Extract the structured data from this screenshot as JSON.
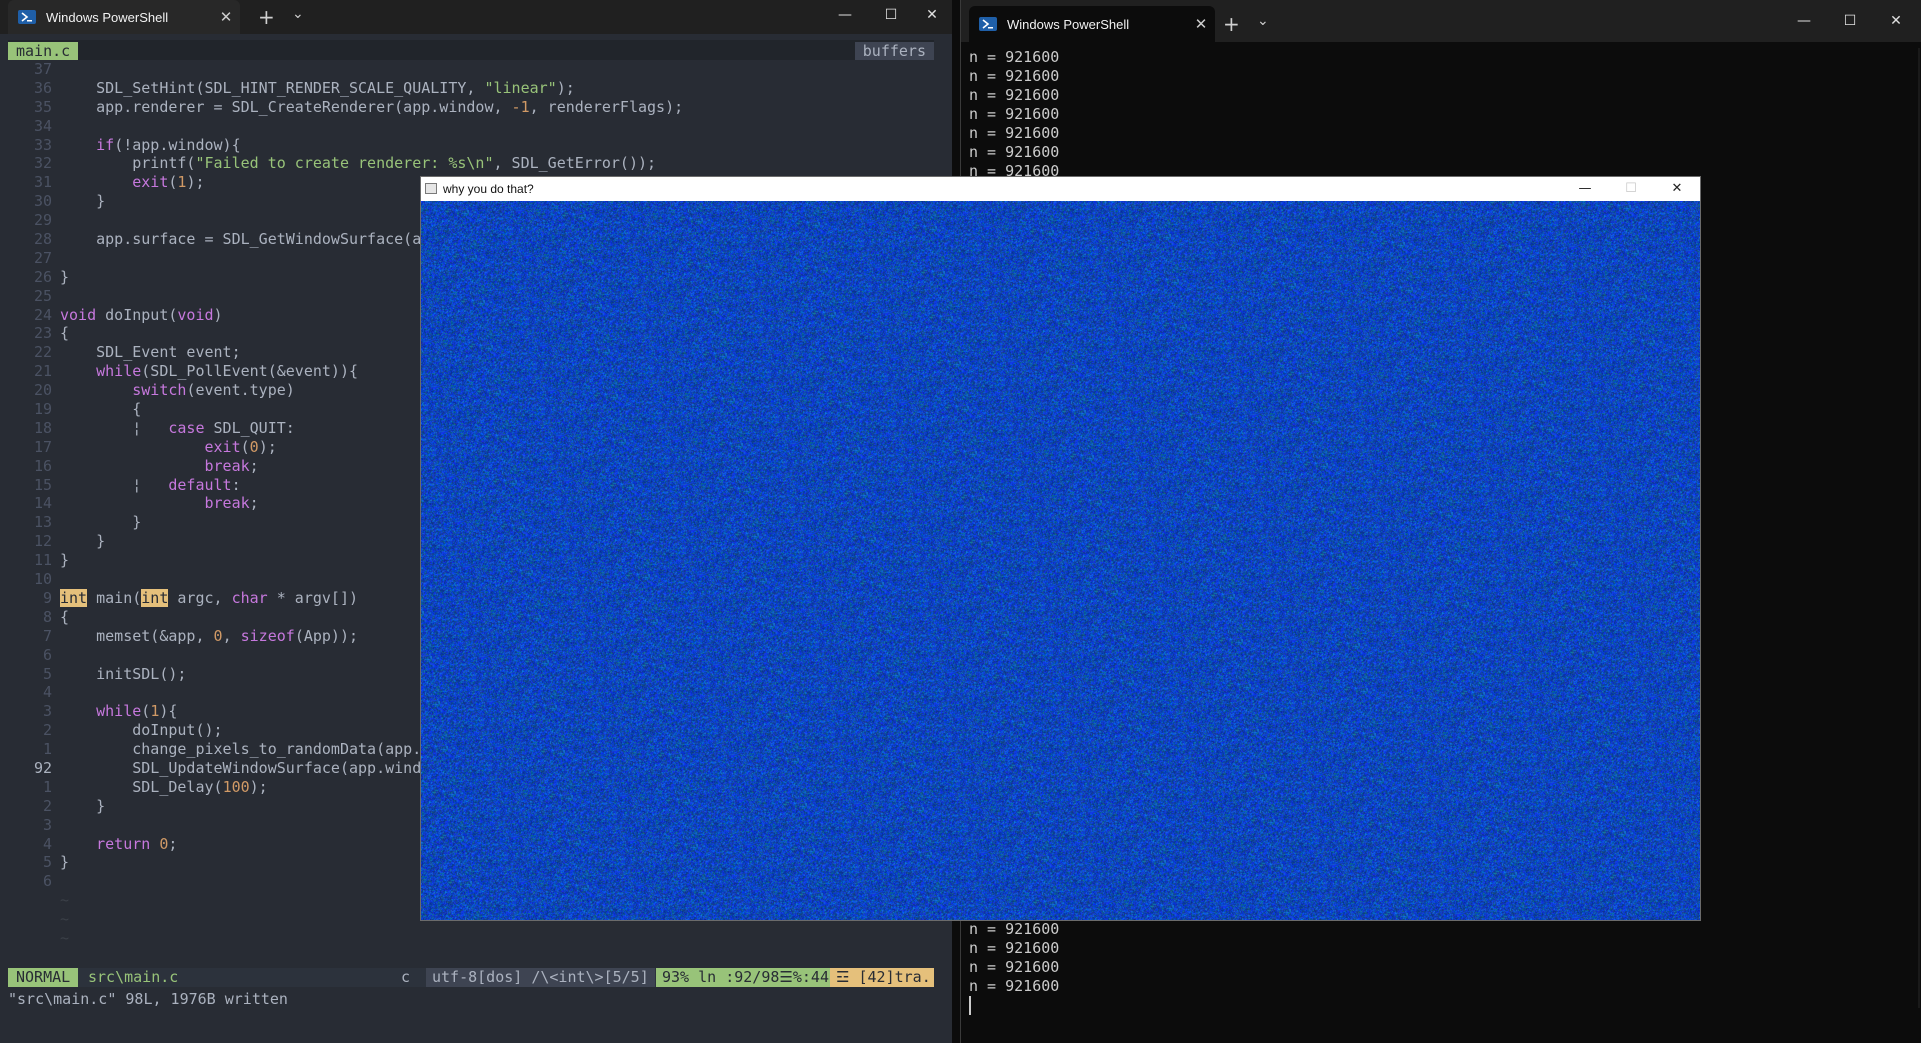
{
  "left_window": {
    "tab_title": "Windows PowerShell",
    "tab_close": "✕",
    "new_tab": "+",
    "dropdown": "⌄",
    "minimize": "—",
    "maximize": "☐",
    "close": "✕"
  },
  "vim": {
    "tab_label": "main.c",
    "buffers_label": "buffers",
    "mode": "NORMAL",
    "file": "src\\main.c",
    "filetype": "c",
    "encoding_search": "utf-8[dos] /\\<int\\>[5/5]",
    "position": "93% ln :92/98☰%:44",
    "trailing": "☲ [42]tra...",
    "cmdline": "\"src\\main.c\" 98L, 1976B written",
    "lines": [
      {
        "n": "37",
        "t": ""
      },
      {
        "n": "36",
        "t": "    SDL_SetHint(SDL_HINT_RENDER_SCALE_QUALITY, \"linear\");"
      },
      {
        "n": "35",
        "t": "    app.renderer = SDL_CreateRenderer(app.window, -1, rendererFlags);"
      },
      {
        "n": "34",
        "t": ""
      },
      {
        "n": "33",
        "t": "    if(!app.window){"
      },
      {
        "n": "32",
        "t": "        printf(\"Failed to create renderer: %s\\n\", SDL_GetError());"
      },
      {
        "n": "31",
        "t": "        exit(1);"
      },
      {
        "n": "30",
        "t": "    }"
      },
      {
        "n": "29",
        "t": ""
      },
      {
        "n": "28",
        "t": "    app.surface = SDL_GetWindowSurface(a"
      },
      {
        "n": "27",
        "t": ""
      },
      {
        "n": "26",
        "t": "}"
      },
      {
        "n": "25",
        "t": ""
      },
      {
        "n": "24",
        "t": "void doInput(void)"
      },
      {
        "n": "23",
        "t": "{"
      },
      {
        "n": "22",
        "t": "    SDL_Event event;"
      },
      {
        "n": "21",
        "t": "    while(SDL_PollEvent(&event)){"
      },
      {
        "n": "20",
        "t": "        switch(event.type)"
      },
      {
        "n": "19",
        "t": "        {"
      },
      {
        "n": "18",
        "t": "        ¦   case SDL_QUIT:"
      },
      {
        "n": "17",
        "t": "                exit(0);"
      },
      {
        "n": "16",
        "t": "                break;"
      },
      {
        "n": "15",
        "t": "        ¦   default:"
      },
      {
        "n": "14",
        "t": "                break;"
      },
      {
        "n": "13",
        "t": "        }"
      },
      {
        "n": "12",
        "t": "    }"
      },
      {
        "n": "11",
        "t": "}"
      },
      {
        "n": "10",
        "t": ""
      },
      {
        "n": "9",
        "t": "int main(int argc, char * argv[])"
      },
      {
        "n": "8",
        "t": "{"
      },
      {
        "n": "7",
        "t": "    memset(&app, 0, sizeof(App));"
      },
      {
        "n": "6",
        "t": ""
      },
      {
        "n": "5",
        "t": "    initSDL();"
      },
      {
        "n": "4",
        "t": ""
      },
      {
        "n": "3",
        "t": "    while(1){"
      },
      {
        "n": "2",
        "t": "        doInput();"
      },
      {
        "n": "1",
        "t": "        change_pixels_to_randomData(app."
      },
      {
        "n": "92",
        "t": "        SDL_UpdateWindowSurface(app.wind"
      },
      {
        "n": "1",
        "t": "        SDL_Delay(100);"
      },
      {
        "n": "2",
        "t": "    }"
      },
      {
        "n": "3",
        "t": ""
      },
      {
        "n": "4",
        "t": "    return 0;"
      },
      {
        "n": "5",
        "t": "}"
      },
      {
        "n": "6",
        "t": ""
      },
      {
        "n": "",
        "t": "~"
      },
      {
        "n": "",
        "t": "~"
      },
      {
        "n": "",
        "t": "~"
      }
    ]
  },
  "right_window": {
    "tab_title": "Windows PowerShell",
    "tab_close": "✕",
    "new_tab": "+",
    "dropdown": "⌄",
    "minimize": "—",
    "maximize": "☐",
    "close": "✕",
    "output_top": [
      "n = 921600",
      "n = 921600",
      "n = 921600",
      "n = 921600",
      "n = 921600",
      "n = 921600",
      "n = 921600"
    ],
    "output_bottom": [
      "n = 921600",
      "n = 921600",
      "n = 921600",
      "n = 921600"
    ]
  },
  "sdl_window": {
    "title": "why you do that?",
    "minimize": "—",
    "maximize": "☐",
    "close": "✕"
  },
  "colors": {
    "vim_bg": "#282c34",
    "keyword": "#c678dd",
    "string": "#98c379",
    "number": "#d19a66",
    "search_highlight": "#e5c07b",
    "noise_base": "#0a2a8a"
  }
}
